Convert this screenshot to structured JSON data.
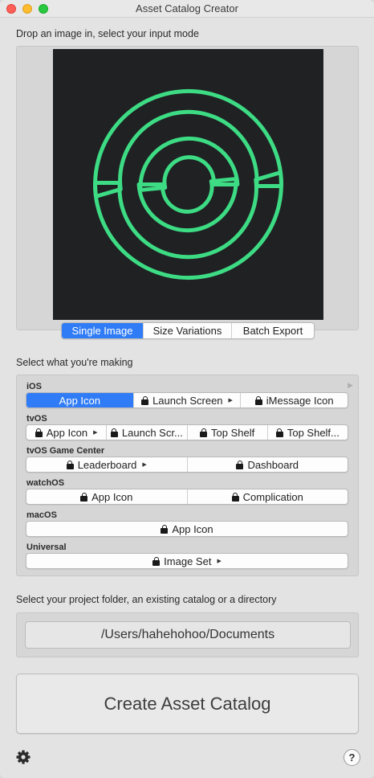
{
  "window": {
    "title": "Asset Catalog Creator"
  },
  "input": {
    "label": "Drop an image in, select your input mode",
    "modes": [
      "Single Image",
      "Size Variations",
      "Batch Export"
    ],
    "selected_mode": "Single Image",
    "preview_icon": "ring-logo-icon",
    "logo_color": "#3ddc84",
    "logo_background": "#1f2123"
  },
  "making": {
    "label": "Select what you're making",
    "groups": [
      {
        "name": "iOS",
        "options": [
          "App Icon",
          "Launch Screen",
          "iMessage Icon"
        ]
      },
      {
        "name": "tvOS",
        "options": [
          "App Icon",
          "Launch Scr...",
          "Top Shelf",
          "Top Shelf..."
        ]
      },
      {
        "name": "tvOS Game Center",
        "options": [
          "Leaderboard",
          "Dashboard"
        ]
      },
      {
        "name": "watchOS",
        "options": [
          "App Icon",
          "Complication"
        ]
      },
      {
        "name": "macOS",
        "options": [
          "App Icon"
        ]
      },
      {
        "name": "Universal",
        "options": [
          "Image Set"
        ]
      }
    ],
    "selected": "iOS / App Icon"
  },
  "project": {
    "label": "Select your project folder, an existing catalog or a directory",
    "path": "/Users/hahehohoo/Documents"
  },
  "actions": {
    "create_label": "Create Asset Catalog",
    "help_label": "?"
  },
  "colors": {
    "accent": "#2f7cf6"
  }
}
